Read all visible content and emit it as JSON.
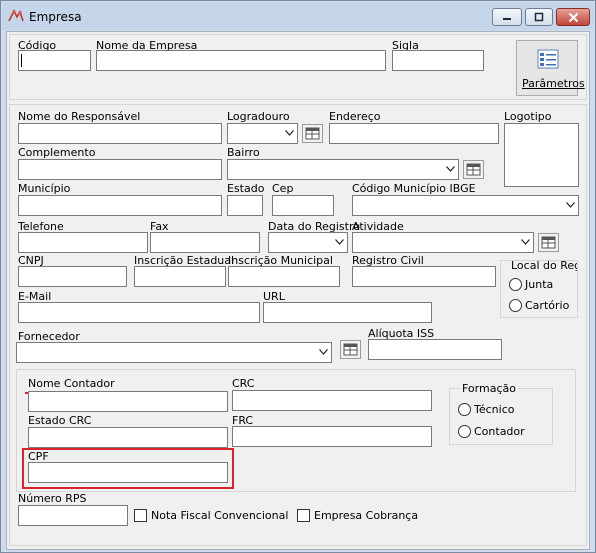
{
  "window": {
    "title": "Empresa",
    "icon": "empresa-app-icon",
    "colors": {
      "titlebar": "#c6d6ea",
      "client": "#f0f0f0",
      "highlight": "#d9232d"
    }
  },
  "header": {
    "codigo_label": "Código",
    "nome_empresa_label": "Nome da Empresa",
    "sigla_label": "Sigla",
    "parametros_label": "Parâmetros",
    "codigo_value": "",
    "nome_empresa_value": "",
    "sigla_value": ""
  },
  "fields": {
    "nome_responsavel": "Nome do Responsável",
    "logradouro": "Logradouro",
    "endereco": "Endereço",
    "logotipo": "Logotipo",
    "complemento": "Complemento",
    "bairro": "Bairro",
    "municipio": "Município",
    "estado": "Estado",
    "cep": "Cep",
    "codigo_municipio_ibge": "Código Município IBGE",
    "telefone": "Telefone",
    "fax": "Fax",
    "data_registro": "Data do Registro",
    "atividade": "Atividade",
    "cnpj": "CNPJ",
    "inscricao_estadual": "Inscrição Estadual",
    "inscricao_municipal": "Inscrição Municipal",
    "registro_civil": "Registro Civil",
    "local_registro": "Local do Regis",
    "local_juntas": "Junta",
    "local_cartorio": "Cartório",
    "email": "E-Mail",
    "url": "URL",
    "fornecedor": "Fornecedor",
    "aliquota_iss": "Alíquota ISS"
  },
  "contador": {
    "nome_contador": "Nome  Contador",
    "crc": "CRC",
    "estado_crc": "Estado CRC",
    "frc": "FRC",
    "cpf": "CPF",
    "formacao": "Formação",
    "tecnico": "Técnico",
    "contador_opt": "Contador"
  },
  "footer": {
    "numero_rps": "Número RPS",
    "nota_fiscal_convencional": "Nota Fiscal Convencional",
    "empresa_cobranca": "Empresa Cobrança"
  }
}
